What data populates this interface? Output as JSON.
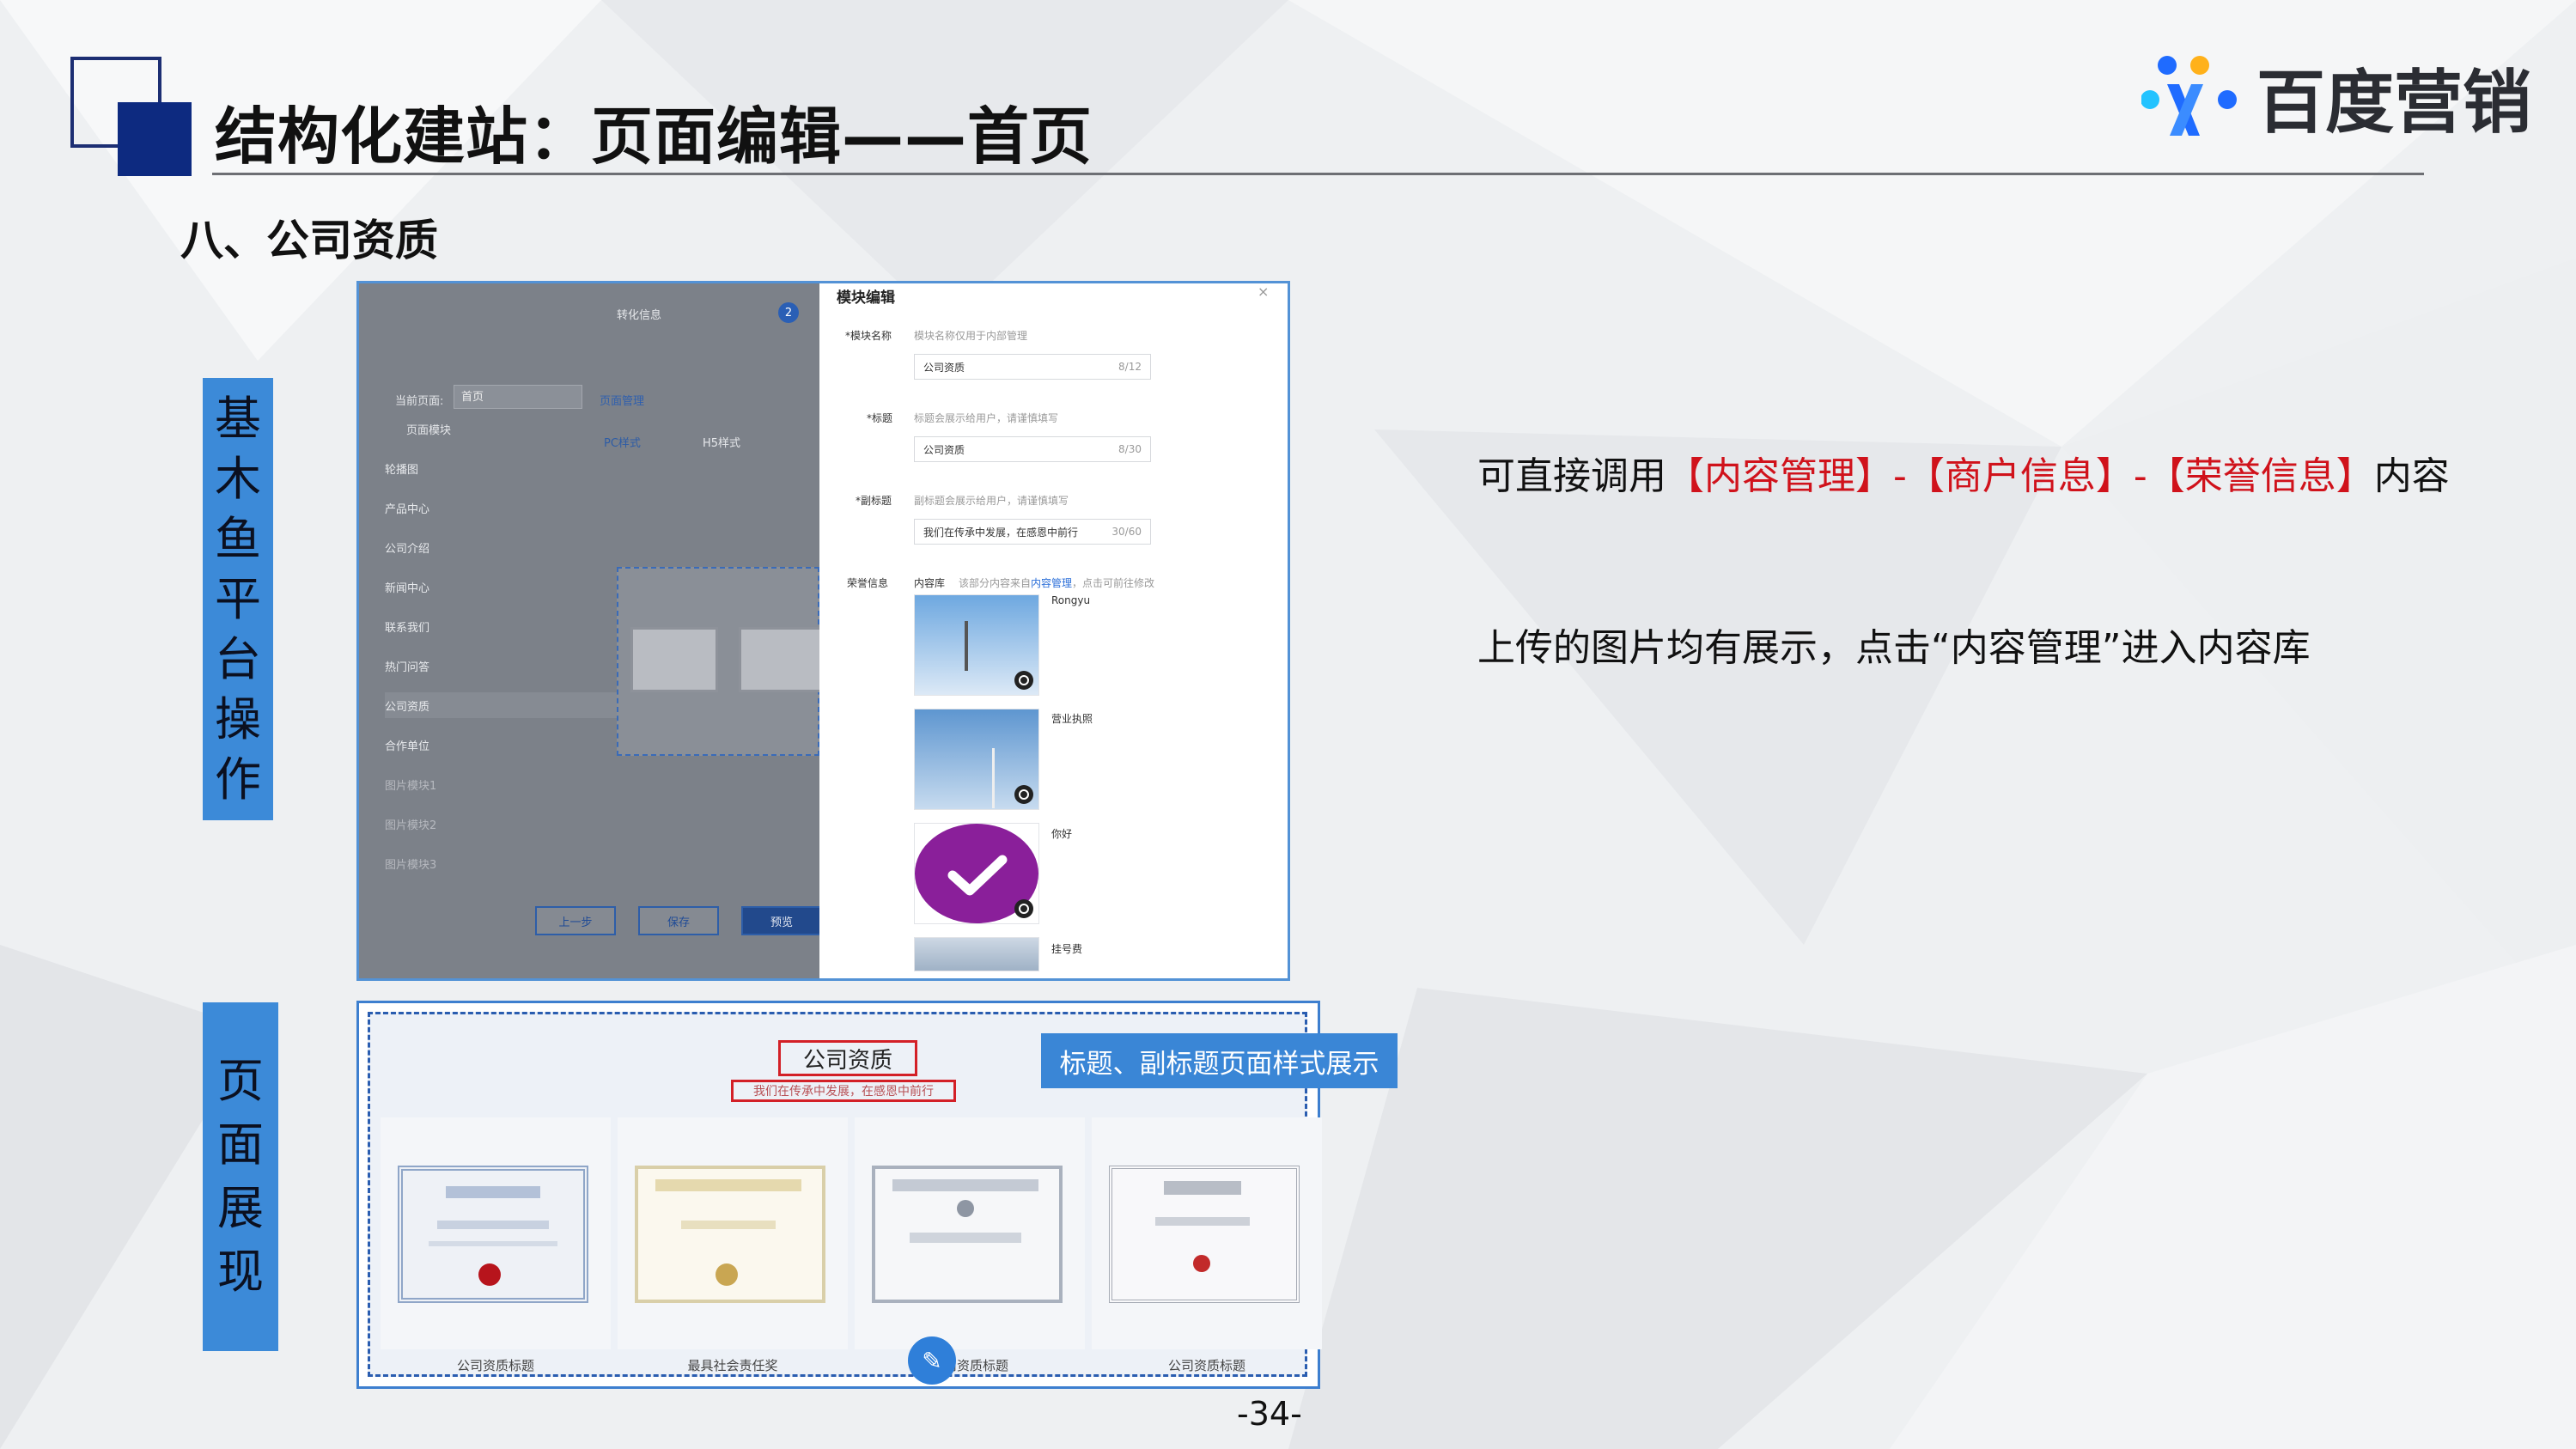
{
  "header": {
    "title": "结构化建站：页面编辑——首页",
    "brand": "百度营销"
  },
  "section": "八、公司资质",
  "side_labels": {
    "operation": [
      "基",
      "木",
      "鱼",
      "平",
      "台",
      "操",
      "作"
    ],
    "display": [
      "页",
      "面",
      "展",
      "现"
    ]
  },
  "editor_bg": {
    "step_label": "转化信息",
    "step_number": "2",
    "current_page_label": "当前页面:",
    "current_page_value": "首页",
    "page_manage_link": "页面管理",
    "page_module_label": "页面模块",
    "tab_pc": "PC样式",
    "tab_h5": "H5样式",
    "modules": [
      "轮播图",
      "产品中心",
      "公司介绍",
      "新闻中心",
      "联系我们",
      "热门问答",
      "公司资质",
      "合作单位",
      "图片模块1",
      "图片模块2",
      "图片模块3"
    ],
    "buttons": [
      "上一步",
      "保存",
      "预览"
    ]
  },
  "module_editor": {
    "title": "模块编辑",
    "close": "×",
    "fields": [
      {
        "label": "*模块名称",
        "hint": "模块名称仅用于内部管理",
        "value": "公司资质",
        "count": "8/12"
      },
      {
        "label": "*标题",
        "hint": "标题会展示给用户，请谨慎填写",
        "value": "公司资质",
        "count": "8/30"
      },
      {
        "label": "*副标题",
        "hint": "副标题会展示给用户，请谨慎填写",
        "value": "我们在传承中发展，在感恩中前行",
        "count": "30/60"
      }
    ],
    "honor_label": "荣誉信息",
    "library_label": "内容库",
    "library_hint_prefix": "该部分内容来自",
    "library_link": "内容管理",
    "library_hint_suffix": "，点击可前往修改",
    "images": [
      "Rongyu",
      "营业执照",
      "你好",
      "挂号费"
    ]
  },
  "description": {
    "line1_prefix": "可直接调用",
    "line1_highlight": "【内容管理】-【商户信息】-【荣誉信息】",
    "line1_suffix": "内容",
    "line2": "上传的图片均有展示，点击“内容管理”进入内容库"
  },
  "preview": {
    "title": "公司资质",
    "subtitle": "我们在传承中发展，在感恩中前行",
    "callout": "标题、副标题页面样式展示",
    "cards": [
      "公司资质标题",
      "最具社会责任奖",
      "公司资质标题",
      "公司资质标题"
    ]
  },
  "page_number": "-34-"
}
